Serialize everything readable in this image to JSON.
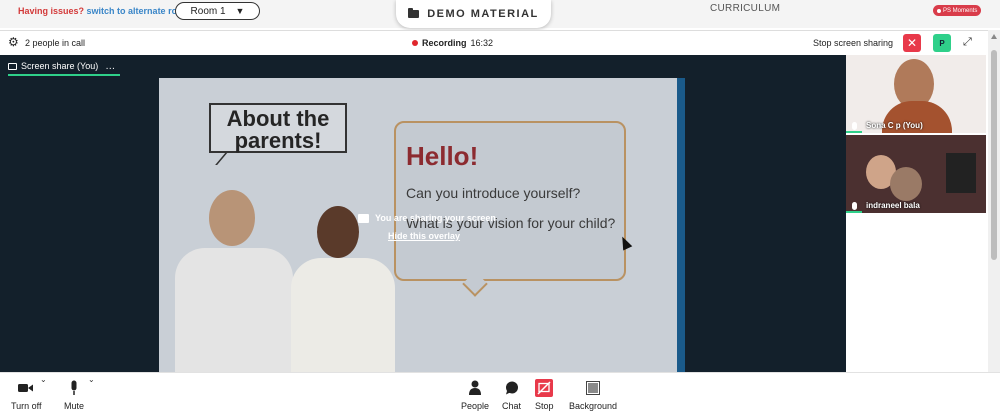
{
  "top": {
    "issues_text": "Having issues?",
    "alternate_link": "switch to alternate room",
    "room_selected": "Room 1",
    "demo_material": "DEMO MATERIAL",
    "curriculum": "CURRICULUM",
    "moments_badge": "PS Moments"
  },
  "call": {
    "people_count": "2 people in call",
    "recording_label": "Recording",
    "recording_time": "16:32",
    "stop_sharing": "Stop screen sharing",
    "participant_initial": "P"
  },
  "share": {
    "tab_label": "Screen share (You)",
    "tab_more": "…",
    "overlay_message": "You are sharing your screen",
    "hide_overlay": "Hide this overlay"
  },
  "slide": {
    "title_line1": "About the",
    "title_line2": "parents!",
    "hello": "Hello!",
    "question1": "Can you introduce yourself?",
    "question2": "What is your vision for your child?"
  },
  "participants": [
    {
      "name": "Sona C p (You)"
    },
    {
      "name": "indraneel bala"
    }
  ],
  "controls": {
    "turn_off": "Turn off",
    "mute": "Mute",
    "people": "People",
    "chat": "Chat",
    "stop": "Stop",
    "background": "Background"
  },
  "colors": {
    "accent_green": "#2fd08a",
    "danger_red": "#e8394a",
    "stage_dark": "#13202b"
  }
}
